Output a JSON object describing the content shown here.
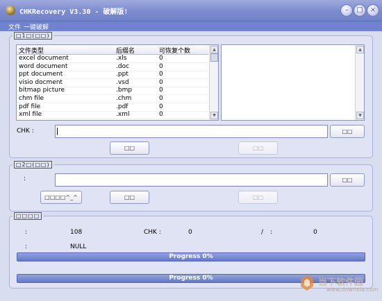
{
  "window": {
    "title": "CHKRecovery V3.30 - 破解版!",
    "controls": [
      "minimize-icon",
      "maximize-icon",
      "close-icon"
    ]
  },
  "menu": [
    "文件",
    "一键破解"
  ],
  "group1": {
    "title": "□1□(□□)",
    "columns": [
      "文件类型",
      "后缀名",
      "可恢复个数"
    ],
    "rows": [
      [
        "excel document",
        ".xls",
        "0"
      ],
      [
        "word document",
        ".doc",
        "0"
      ],
      [
        "ppt document",
        ".ppt",
        "0"
      ],
      [
        "visio docment",
        ".vsd",
        "0"
      ],
      [
        "bitmap picture",
        ".bmp",
        "0"
      ],
      [
        "chm file",
        ".chm",
        "0"
      ],
      [
        "pdf file",
        ".pdf",
        "0"
      ],
      [
        "xml file",
        ".xml",
        "0"
      ]
    ],
    "chk_label": "CHK :",
    "chk_value": "",
    "browse_btn": "□□",
    "btn_a": "□□",
    "btn_b": "□□"
  },
  "group2": {
    "title": "□2□(□□)",
    "label": ":",
    "value": "",
    "browse_btn": "□□",
    "btn_special": "□□□□^_^",
    "btn_a": "□□",
    "btn_b": "□□"
  },
  "group3": {
    "title": "□□□□",
    "label1": ":",
    "value1": "108",
    "chk_label": "CHK :",
    "chk_value": "0",
    "slash": "/",
    "label2": ":",
    "value2": "0",
    "label3": ":",
    "value3": "NULL",
    "progress1": {
      "text": "Progress 0%",
      "fraction": 0
    },
    "progress2": {
      "text": "Progress 0%",
      "fraction": 0
    }
  },
  "watermark": {
    "text": "当下软件园",
    "url": "www.downxia.com"
  },
  "colors": {
    "accent": "#6f83d0",
    "progress": "#6579c6"
  }
}
